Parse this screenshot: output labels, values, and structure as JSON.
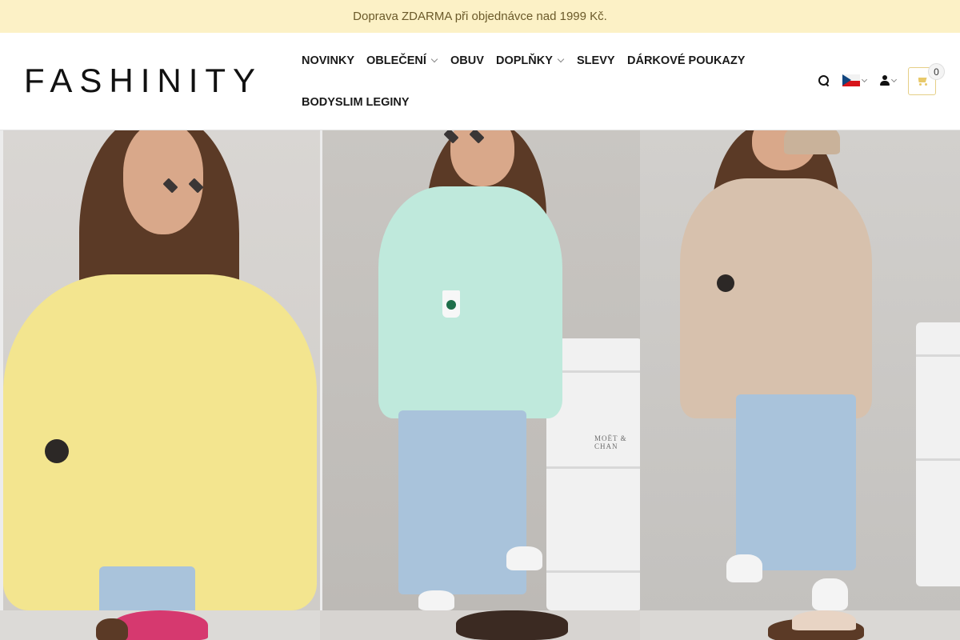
{
  "announcement": {
    "text": "Doprava ZDARMA při objednávce nad 1999 Kč."
  },
  "header": {
    "logo_text": "FASHINITY",
    "nav": [
      {
        "label": "NOVINKY",
        "has_dropdown": false
      },
      {
        "label": "OBLEČENÍ",
        "has_dropdown": true
      },
      {
        "label": "OBUV",
        "has_dropdown": false
      },
      {
        "label": "DOPLŇKY",
        "has_dropdown": true
      },
      {
        "label": "SLEVY",
        "has_dropdown": false
      },
      {
        "label": "DÁRKOVÉ POUKAZY",
        "has_dropdown": false
      },
      {
        "label": "BODYSLIM LEGINY",
        "has_dropdown": false
      }
    ],
    "tools": {
      "search_icon": "search-icon",
      "language_flag": "czech-flag",
      "account_icon": "user-icon",
      "cart_icon": "shopping-cart-icon",
      "cart_count": "0"
    }
  },
  "gallery": {
    "tiles": [
      {
        "color": "#f3e58f",
        "description_icon": "product-photo-yellow-sweatshirt"
      },
      {
        "color": "#bfe9dc",
        "description_icon": "product-photo-mint-sweatshirt"
      },
      {
        "color": "#d7c1ad",
        "description_icon": "product-photo-beige-sweatshirt"
      },
      {
        "color": "#d6396f",
        "description_icon": "product-photo-pink-cap"
      },
      {
        "color": "#3b2a22",
        "description_icon": "product-photo-dark"
      },
      {
        "color": "#e8d4c4",
        "description_icon": "product-photo-beige-cap"
      }
    ],
    "barrel_text": "MOËT & CHAN"
  },
  "colors": {
    "announcement_bg": "#fcf1c6",
    "cart_accent": "#e8c96a"
  }
}
